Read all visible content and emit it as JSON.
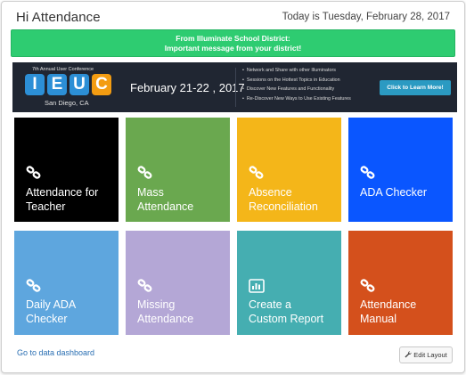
{
  "header": {
    "greeting": "Hi Attendance",
    "today_text": "Today is Tuesday, February 28, 2017"
  },
  "notice": {
    "title": "From Illuminate School District:",
    "message": "Important message from your district!",
    "color": "#2ecc71"
  },
  "banner": {
    "pretitle": "7th Annual User Conference",
    "logo_letters": [
      "I",
      "E",
      "U",
      "C"
    ],
    "logo_colors": [
      "#2c8fd6",
      "#2c8fd6",
      "#2c8fd6",
      "#f39c12"
    ],
    "location": "San Diego, CA",
    "dates": "February 21-22 , 2017",
    "bullets": [
      "Network and Share with other Illuminators",
      "Sessions on the Hottest Topics in Education",
      "Discover New Features and Functionality",
      "Re-Discover New Ways to Use Existing Features"
    ],
    "button_label": "Click to Learn More!"
  },
  "tiles": [
    {
      "lines": [
        "Attendance for",
        "Teacher"
      ],
      "color": "#000000",
      "icon": "link-icon"
    },
    {
      "lines": [
        "Mass",
        "Attendance"
      ],
      "color": "#6aa84f",
      "icon": "link-icon"
    },
    {
      "lines": [
        "Absence",
        "Reconciliation"
      ],
      "color": "#f4b619",
      "icon": "link-icon"
    },
    {
      "lines": [
        "ADA Checker"
      ],
      "color": "#0a56ff",
      "icon": "link-icon"
    },
    {
      "lines": [
        "Daily ADA",
        "Checker"
      ],
      "color": "#5ea6de",
      "icon": "link-icon"
    },
    {
      "lines": [
        "Missing",
        "Attendance"
      ],
      "color": "#b4a7d6",
      "icon": "link-icon"
    },
    {
      "lines": [
        "Create a",
        "Custom Report"
      ],
      "color": "#45aeb1",
      "icon": "bar-chart-icon"
    },
    {
      "lines": [
        "Attendance",
        "Manual"
      ],
      "color": "#d4501c",
      "icon": "link-icon"
    }
  ],
  "footer": {
    "dashboard_link": "Go to data dashboard",
    "edit_layout": "Edit Layout"
  }
}
